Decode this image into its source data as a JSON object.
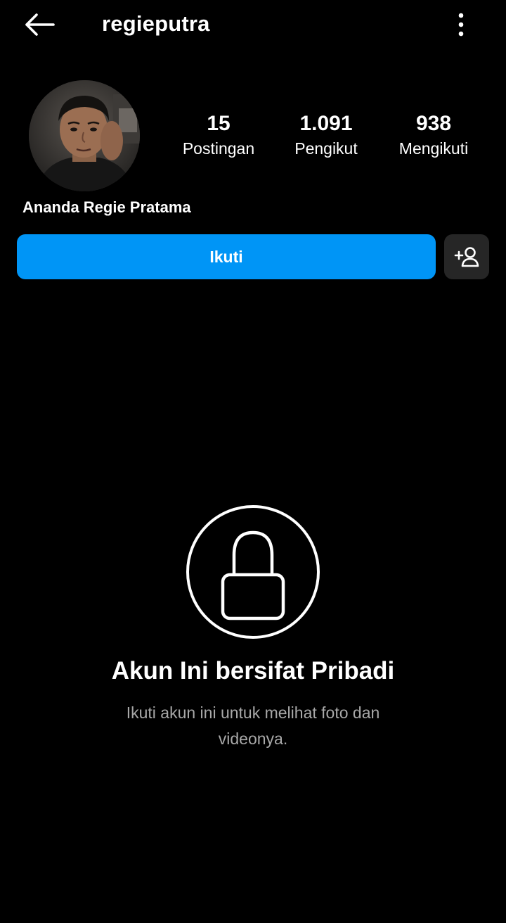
{
  "header": {
    "username": "regieputra",
    "back_icon": "arrow-left-icon",
    "more_icon": "more-vertical-icon"
  },
  "profile": {
    "display_name": "Ananda Regie Pratama",
    "avatar_alt": "profile-photo",
    "stats": [
      {
        "value": "15",
        "label": "Postingan"
      },
      {
        "value": "1.091",
        "label": "Pengikut"
      },
      {
        "value": "938",
        "label": "Mengikuti"
      }
    ]
  },
  "actions": {
    "follow_label": "Ikuti",
    "suggest_icon": "add-person-icon"
  },
  "private": {
    "icon": "lock-icon",
    "title": "Akun Ini bersifat Pribadi",
    "description": "Ikuti akun ini untuk melihat foto dan videonya."
  },
  "colors": {
    "background": "#000000",
    "accent": "#0095f6",
    "secondary_button": "#262626",
    "muted_text": "#a8a8a8"
  }
}
